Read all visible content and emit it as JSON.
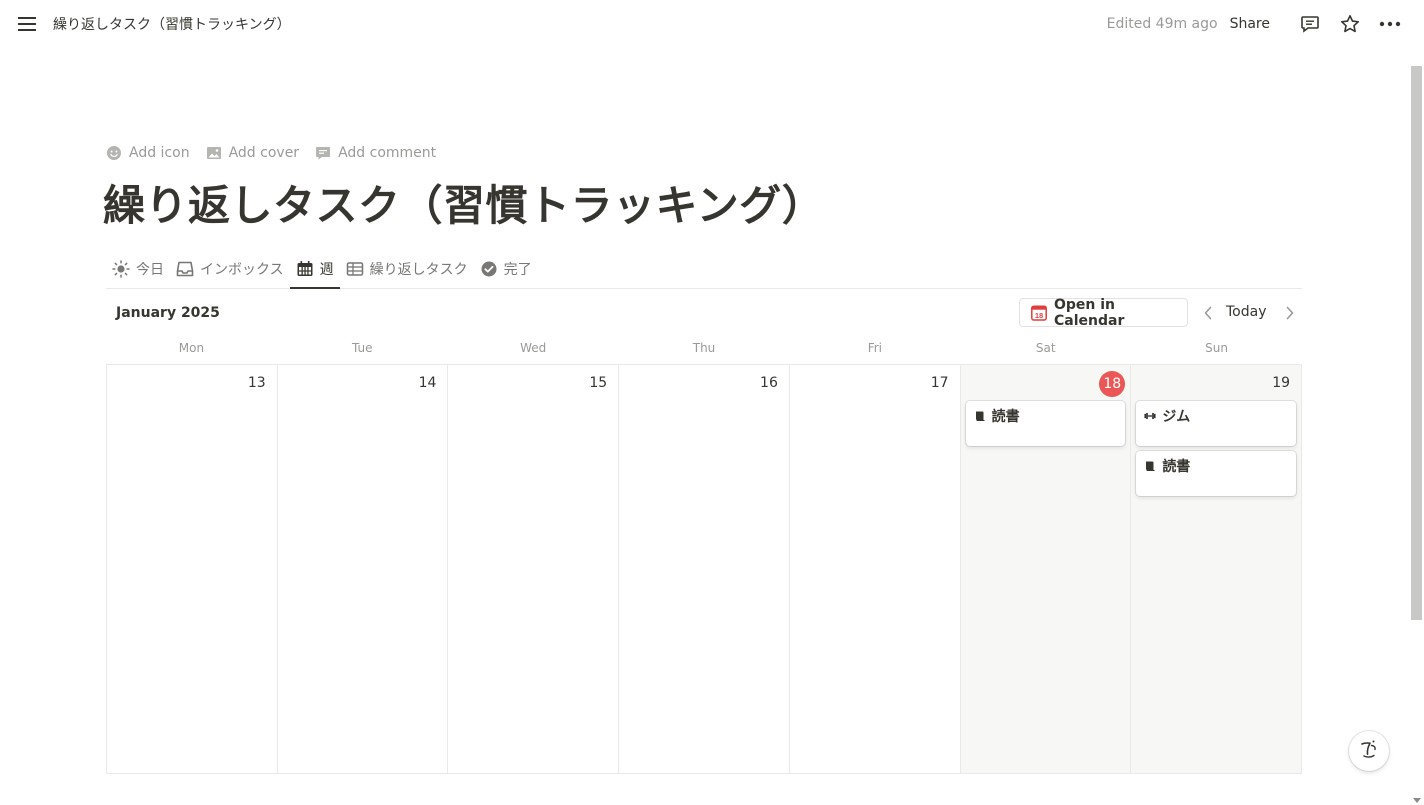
{
  "topbar": {
    "page_title": "繰り返しタスク（習慣トラッキング）",
    "edited": "Edited 49m ago",
    "share_label": "Share"
  },
  "page": {
    "actions": {
      "add_icon": "Add icon",
      "add_cover": "Add cover",
      "add_comment": "Add comment"
    },
    "title": "繰り返しタスク（習慣トラッキング）"
  },
  "tabs": [
    {
      "label": "今日",
      "icon": "sun-icon"
    },
    {
      "label": "インボックス",
      "icon": "inbox-icon"
    },
    {
      "label": "週",
      "icon": "calendar-icon",
      "active": true
    },
    {
      "label": "繰り返しタスク",
      "icon": "table-icon"
    },
    {
      "label": "完了",
      "icon": "check-circle-icon"
    }
  ],
  "calendar": {
    "month_label": "January 2025",
    "open_in_calendar": "Open in Calendar",
    "open_in_calendar_icon_text": "18",
    "today_label": "Today",
    "weekdays": [
      "Mon",
      "Tue",
      "Wed",
      "Thu",
      "Fri",
      "Sat",
      "Sun"
    ],
    "days": [
      {
        "num": "13",
        "events": []
      },
      {
        "num": "14",
        "events": []
      },
      {
        "num": "15",
        "events": []
      },
      {
        "num": "16",
        "events": []
      },
      {
        "num": "17",
        "events": []
      },
      {
        "num": "18",
        "today": true,
        "events": [
          {
            "title": "読書",
            "icon": "book-icon"
          }
        ]
      },
      {
        "num": "19",
        "events": [
          {
            "title": "ジム",
            "icon": "dumbbell-icon"
          },
          {
            "title": "読書",
            "icon": "book-icon"
          }
        ]
      }
    ]
  },
  "colors": {
    "accent_today": "#eb5757",
    "text": "#37352f",
    "muted": "#9b9a97",
    "weekend_bg": "#f7f7f5"
  }
}
